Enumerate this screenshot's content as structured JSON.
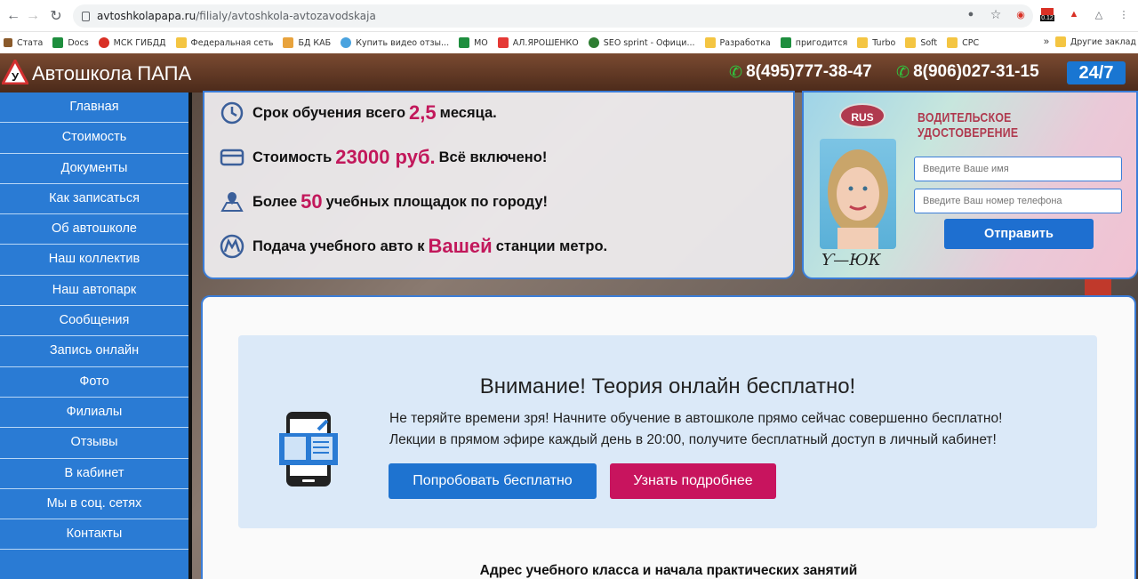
{
  "browser": {
    "url_host": "avtoshkolapapa.ru",
    "url_path": "/filialy/avtoshkola-avtozavodskaja",
    "bookmarks": [
      "Стата",
      "Docs",
      "МСК ГИБДД",
      "Федеральная сеть",
      "БД КАБ",
      "Купить видео отзы...",
      "МО",
      "АЛ.ЯРОШЕНКО",
      "SEO sprint - Офици...",
      "Разработка",
      "пригодится",
      "Turbo",
      "Soft",
      "CPC"
    ],
    "bookmarks_more": "»",
    "other_bookmarks": "Другие заклад",
    "ext_badge": "0.12"
  },
  "header": {
    "logo_letter": "У",
    "title": "Автошкола ПАПА",
    "phone1": "8(495)777-38-47",
    "phone2": "8(906)027-31-15",
    "badge": "24/7"
  },
  "sidebar": {
    "items": [
      "Главная",
      "Стоимость",
      "Документы",
      "Как записаться",
      "Об автошколе",
      "Наш коллектив",
      "Наш автопарк",
      "Сообщения",
      "Запись онлайн",
      "Фото",
      "Филиалы",
      "Отзывы",
      "В кабинет",
      "Мы в соц. сетях",
      "Контакты"
    ]
  },
  "info": {
    "row1_pre": "Срок обучения всего",
    "row1_hl": "2,5",
    "row1_post": "месяца.",
    "row2_pre": "Стоимость",
    "row2_hl": "23000 руб.",
    "row2_post": "Всё включено!",
    "row3_pre": "Более",
    "row3_hl": "50",
    "row3_post": "учебных площадок по городу!",
    "row4_pre": "Подача учебного авто к",
    "row4_hl": "Вашей",
    "row4_post": "станции метро."
  },
  "license": {
    "rus": "RUS",
    "title": "ВОДИТЕЛЬСКОЕ УДОСТОВЕРЕНИЕ",
    "name_placeholder": "Введите Ваше имя",
    "phone_placeholder": "Введите Ваш номер телефона",
    "submit": "Отправить",
    "signature": "Ƴ—ЮК"
  },
  "promo": {
    "title": "Внимание! Теория онлайн бесплатно!",
    "line1": "Не теряйте времени зря! Начните обучение в автошколе прямо сейчас совершенно бесплатно!",
    "line2": "Лекции в прямом эфире каждый день в 20:00, получите бесплатный доступ в личный кабинет!",
    "btn_try": "Попробовать бесплатно",
    "btn_more": "Узнать подробнее"
  },
  "address_heading": "Адрес учебного класса и начала практических занятий",
  "colors": {
    "accent": "#2a7bd4",
    "highlight": "#c2185b",
    "header_brown": "#5e3520",
    "pink_button": "#c8145e"
  }
}
